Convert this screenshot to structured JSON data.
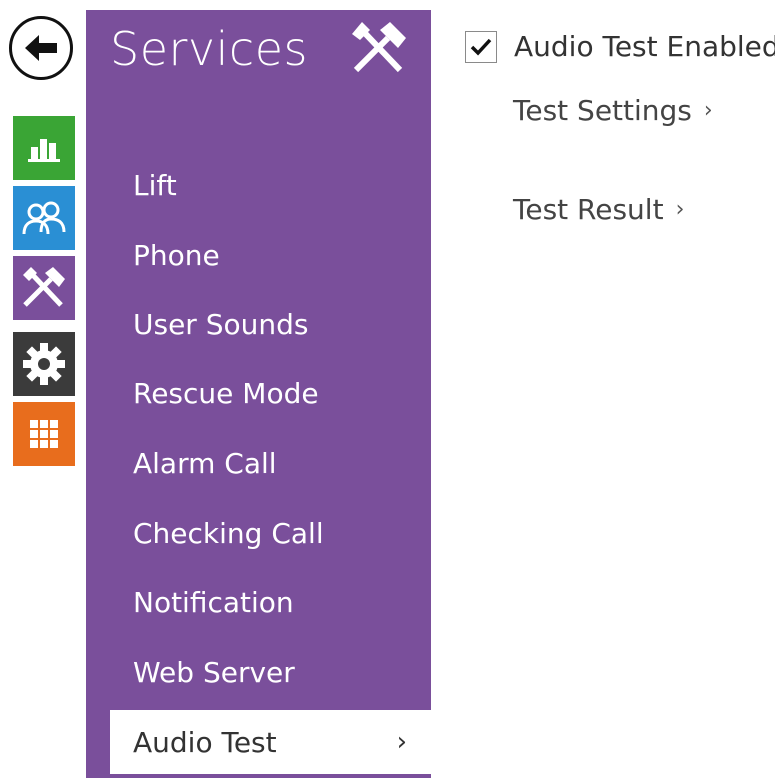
{
  "rail": {
    "items": [
      {
        "icon": "bar-chart-icon",
        "color": "#3aa535"
      },
      {
        "icon": "users-icon",
        "color": "#2a8fd4"
      },
      {
        "icon": "tools-icon",
        "color": "#7a4f9b"
      },
      {
        "icon": "gear-icon",
        "color": "#3b3b3b"
      },
      {
        "icon": "grid-icon",
        "color": "#e86d1d"
      }
    ]
  },
  "panel": {
    "title": "Services",
    "items": [
      "Lift",
      "Phone",
      "User Sounds",
      "Rescue Mode",
      "Alarm Call",
      "Checking Call",
      "Notification",
      "Web Server",
      "Audio Test"
    ],
    "active_chevron": "›"
  },
  "content": {
    "audio_test_enabled": {
      "label": "Audio Test Enabled",
      "checked": true
    },
    "test_settings": "Test Settings",
    "test_result": "Test Result",
    "chevron": "›"
  },
  "colors": {
    "accent": "#7a4f9b"
  }
}
